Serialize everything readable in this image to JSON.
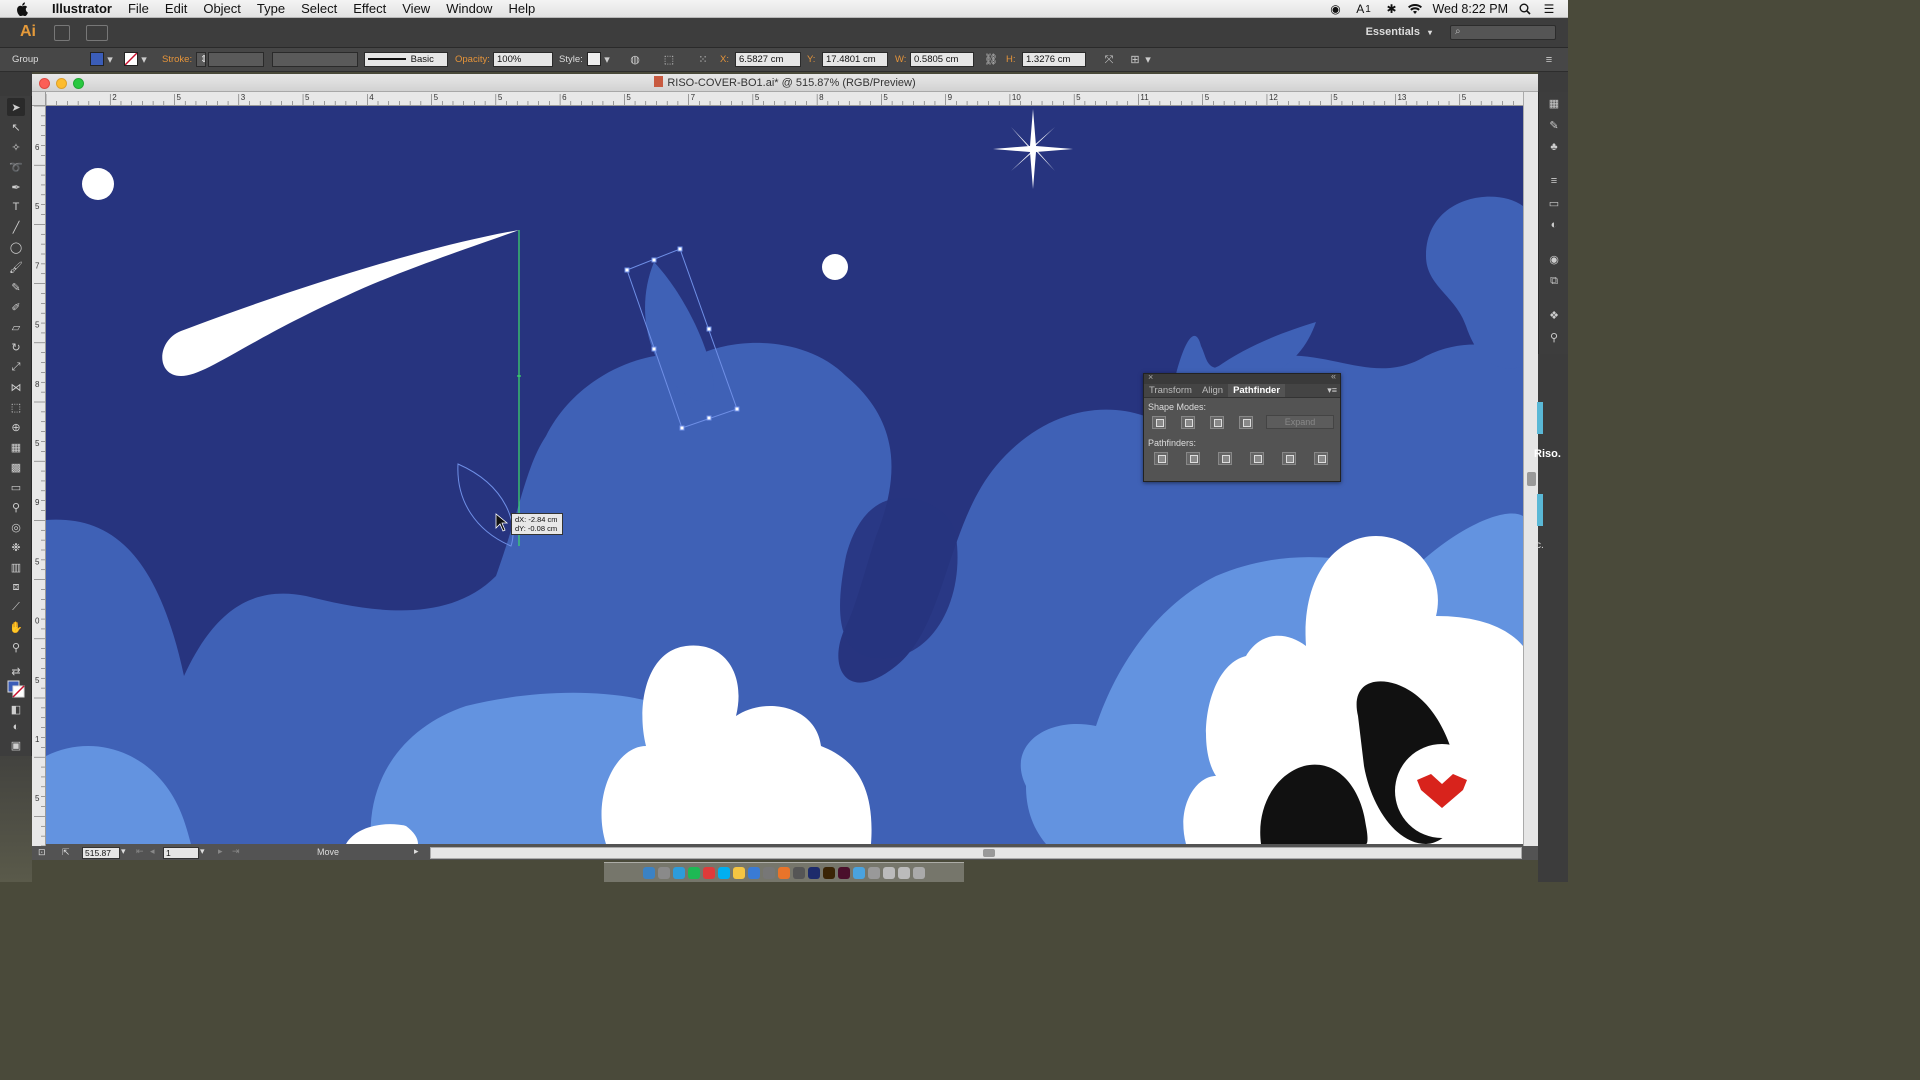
{
  "menubar": {
    "app": "Illustrator",
    "items": [
      "File",
      "Edit",
      "Object",
      "Type",
      "Select",
      "Effect",
      "View",
      "Window",
      "Help"
    ],
    "clock": "Wed 8:22 PM",
    "adobe_count": "1"
  },
  "appbar": {
    "logo": "Ai",
    "workspace": "Essentials",
    "search_placeholder": ""
  },
  "controlbar": {
    "selection_type": "Group",
    "stroke_label": "Stroke:",
    "brush_label": "Basic",
    "opacity_label": "Opacity:",
    "opacity_value": "100%",
    "style_label": "Style:",
    "x_label": "X:",
    "x_value": "6.5827 cm",
    "y_label": "Y:",
    "y_value": "17.4801 cm",
    "w_label": "W:",
    "w_value": "0.5805 cm",
    "h_label": "H:",
    "h_value": "1.3276 cm",
    "fill_color": "#3b5db8",
    "stroke_color": "#c8102e"
  },
  "document": {
    "title": "RISO-COVER-BO1.ai* @ 515.87% (RGB/Preview)",
    "ruler_top": [
      "2",
      "5",
      "3",
      "5",
      "4",
      "5",
      "5",
      "6",
      "5",
      "7",
      "5",
      "8",
      "5",
      "9",
      "10",
      "5",
      "11",
      "5",
      "12",
      "5",
      "13",
      "5"
    ],
    "ruler_left": [
      "6",
      "5",
      "7",
      "5",
      "8",
      "5",
      "9",
      "5",
      "0",
      "5",
      "1",
      "5"
    ]
  },
  "pathfinder": {
    "tabs": [
      "Transform",
      "Align",
      "Pathfinder"
    ],
    "active_tab": "Pathfinder",
    "shape_modes_label": "Shape Modes:",
    "expand_label": "Expand",
    "pathfinders_label": "Pathfinders:"
  },
  "tooltip": {
    "dx": "dX: -2.84 cm",
    "dy": "dY: -0.08 cm"
  },
  "statusbar": {
    "zoom": "515.87",
    "artboard": "1",
    "tool_status": "Move"
  },
  "desktop": {
    "riso_text": "Riso.",
    "c_text": "c."
  },
  "colors": {
    "canvas_bg": "#27347f",
    "mid_blue": "#3f61b6",
    "light_blue": "#6393e0",
    "white": "#ffffff",
    "logo_red": "#d8231c",
    "guide_green": "#3ddc6a"
  }
}
